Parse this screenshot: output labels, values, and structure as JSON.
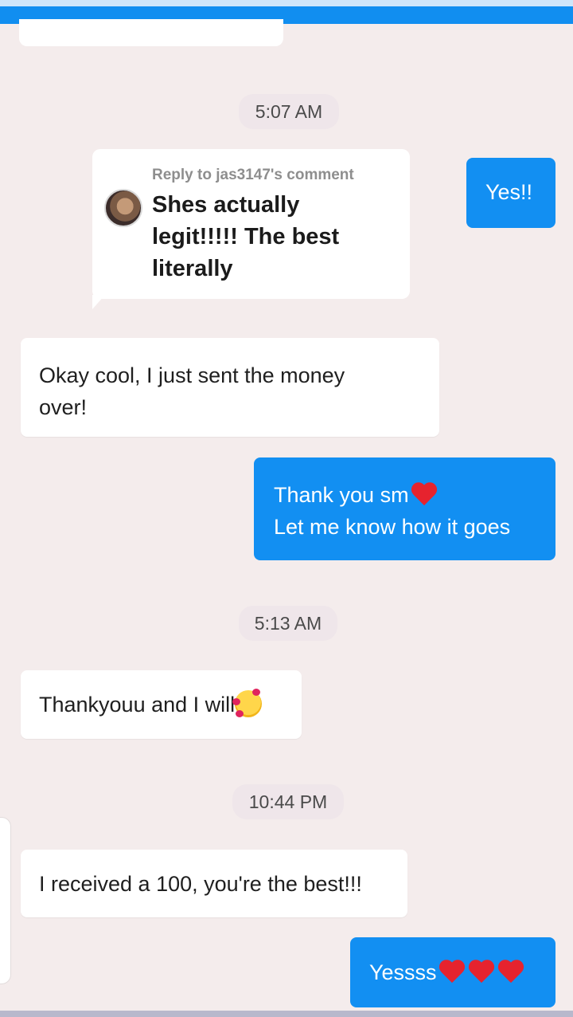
{
  "messages": [
    {
      "id": "m-yes",
      "text": "Yes!!"
    },
    {
      "id": "m-okay",
      "text": "Okay cool, I just sent the money\nover!"
    },
    {
      "id": "m-thanks",
      "text_1": "Thank you sm",
      "text_2": "Let me know how it goes"
    },
    {
      "id": "m-thankyouu",
      "text": "Thankyouu and I will"
    },
    {
      "id": "m-received",
      "text": "I received a 100, you're the best!!!"
    },
    {
      "id": "m-yessss",
      "text": "Yessss"
    }
  ],
  "timestamps": [
    "5:07 AM",
    "5:13 AM",
    "10:44 PM"
  ],
  "reply": {
    "header": "Reply to jas3147's comment",
    "body": "Shes actually\nlegit!!!!! The best\nliterally"
  },
  "colors": {
    "background": "#f4ecec",
    "outgoing_bubble": "#128ff2",
    "incoming_bubble": "#ffffff",
    "top_bar": "#118ef0"
  },
  "icons": [
    "red-heart-emoji",
    "smiling-face-with-hearts-emoji"
  ]
}
